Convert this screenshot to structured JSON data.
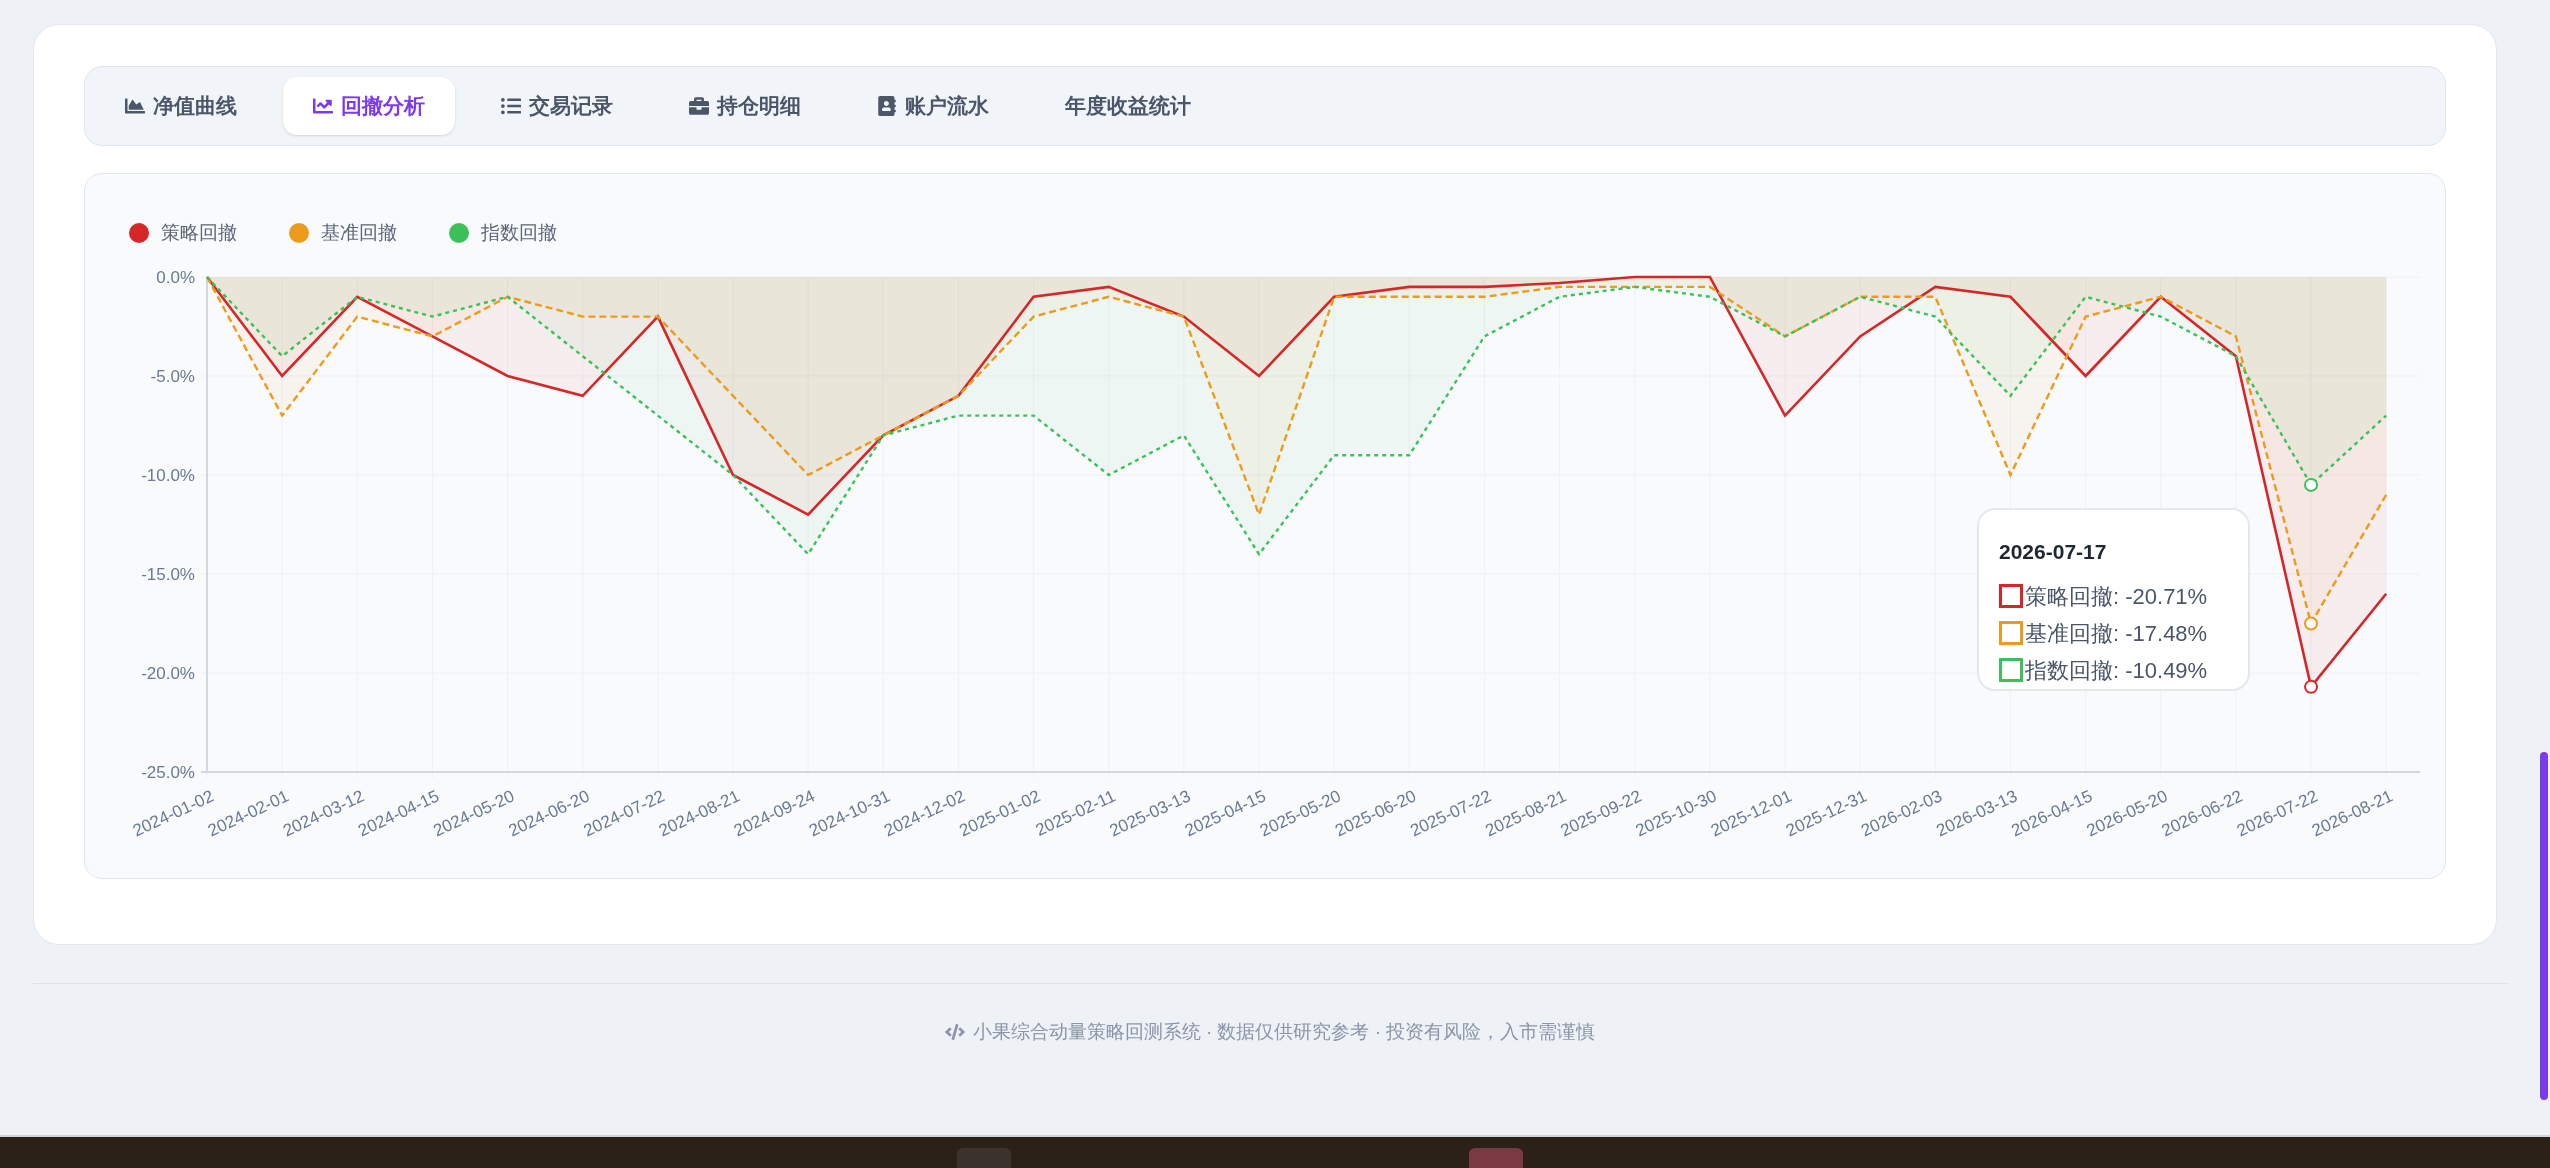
{
  "tabs": [
    {
      "label": "净值曲线",
      "selected": false
    },
    {
      "label": "回撤分析",
      "selected": true
    },
    {
      "label": "交易记录",
      "selected": false
    },
    {
      "label": "持仓明细",
      "selected": false
    },
    {
      "label": "账户流水",
      "selected": false
    },
    {
      "label": "年度收益统计",
      "selected": false
    }
  ],
  "drawdown_chart": {
    "chart_data": {
      "type": "area",
      "x": [
        "2024-01-02",
        "2024-02-01",
        "2024-03-12",
        "2024-04-15",
        "2024-05-20",
        "2024-06-20",
        "2024-07-22",
        "2024-08-21",
        "2024-09-24",
        "2024-10-31",
        "2024-12-02",
        "2025-01-02",
        "2025-02-11",
        "2025-03-13",
        "2025-04-15",
        "2025-05-20",
        "2025-06-20",
        "2025-07-22",
        "2025-08-21",
        "2025-09-22",
        "2025-10-30",
        "2025-12-01",
        "2025-12-31",
        "2026-02-03",
        "2026-03-13",
        "2026-04-15",
        "2026-05-20",
        "2026-06-22",
        "2026-07-22",
        "2026-08-21"
      ],
      "series": [
        {
          "name": "策略回撤",
          "color": "#d62728",
          "values": [
            0,
            -5,
            -1,
            -3,
            -5,
            -6,
            -2,
            -10,
            -12,
            -8,
            -6,
            -1,
            -0.5,
            -2,
            -5,
            -1,
            -0.5,
            -0.5,
            -0.3,
            0,
            0,
            -7,
            -3,
            -0.5,
            -1,
            -5,
            -1,
            -4,
            -20.7,
            -16
          ]
        },
        {
          "name": "基准回撤",
          "color": "#ec9b1c",
          "values": [
            0,
            -7,
            -2,
            -3,
            -1,
            -2,
            -2,
            -6,
            -10,
            -8,
            -6,
            -2,
            -1,
            -2,
            -12,
            -1,
            -1,
            -1,
            -0.5,
            -0.5,
            -0.5,
            -3,
            -1,
            -1,
            -10,
            -2,
            -1,
            -3,
            -17.5,
            -11
          ]
        },
        {
          "name": "指数回撤",
          "color": "#3cc15a",
          "values": [
            0,
            -4,
            -1,
            -2,
            -1,
            -4,
            -7,
            -10,
            -14,
            -8,
            -7,
            -7,
            -10,
            -8,
            -14,
            -9,
            -9,
            -3,
            -1,
            -0.5,
            -1,
            -3,
            -1,
            -2,
            -6,
            -1,
            -2,
            -4,
            -10.5,
            -7
          ]
        }
      ],
      "ylim": [
        -25,
        0
      ],
      "yticks": [
        {
          "value": 0,
          "label": "0.0%"
        },
        {
          "value": -5,
          "label": "-5.0%"
        },
        {
          "value": -10,
          "label": "-10.0%"
        },
        {
          "value": -15,
          "label": "-15.0%"
        },
        {
          "value": -20,
          "label": "-20.0%"
        },
        {
          "value": -25,
          "label": "-25.0%"
        }
      ],
      "grid": true
    },
    "tooltip": {
      "date": "2026-07-17",
      "items": [
        {
          "label": "策略回撤: -20.71%",
          "color": "#d62728"
        },
        {
          "label": "基准回撤: -17.48%",
          "color": "#ec9b1c"
        },
        {
          "label": "指数回撤: -10.49%",
          "color": "#3cc15a"
        }
      ]
    }
  },
  "footer": "小果综合动量策略回测系统 · 数据仅供研究参考 · 投资有风险，入市需谨慎"
}
